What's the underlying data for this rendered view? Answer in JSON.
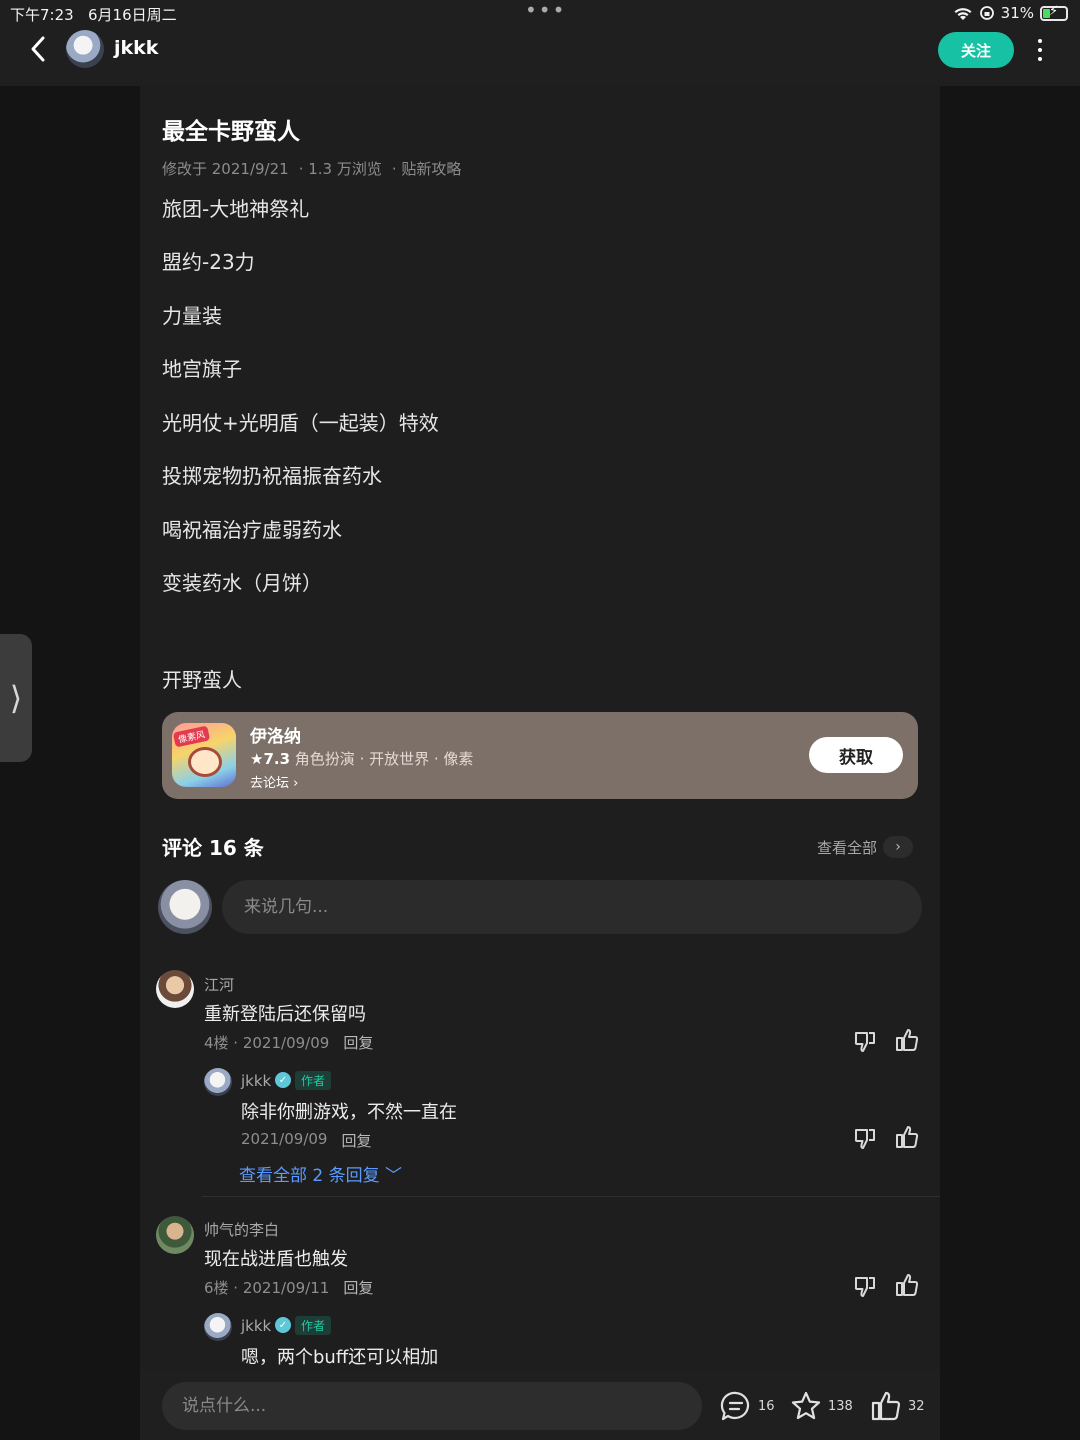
{
  "status": {
    "time": "下午7:23",
    "date": "6月16日周二",
    "battery": "31%",
    "battery_level": 0.31
  },
  "header": {
    "author": "jkkk",
    "follow_label": "关注"
  },
  "side_tab": {
    "glyph": "⟩"
  },
  "post": {
    "title": "最全卡野蛮人",
    "modified": "修改于 2021/9/21",
    "views": "· 1.3 万浏览",
    "category": "· 贴新攻略",
    "lines": [
      "旅团-大地神祭礼",
      "盟约-23力",
      "力量装",
      "地宫旗子",
      "光明仗+光明盾（一起装）特效",
      "投掷宠物扔祝福振奋药水",
      "喝祝福治疗虚弱药水",
      "变装药水（月饼）",
      "开野蛮人"
    ]
  },
  "game_card": {
    "name": "伊洛纳",
    "rating": "★7.3",
    "tags": " 角色扮演 · 开放世界 · 像素",
    "forum_link": "去论坛",
    "get_label": "获取",
    "icon_badge": "像素风"
  },
  "comments_section": {
    "title": "评论 16 条",
    "view_all": "查看全部",
    "input_placeholder": "来说几句..."
  },
  "comments": [
    {
      "name": "江河",
      "text": "重新登陆后还保留吗",
      "info": "4楼 · 2021/09/09",
      "reply_label": "回复",
      "reply": {
        "name": "jkkk",
        "author_tag": "作者",
        "text": "除非你删游戏，不然一直在",
        "date": "2021/09/09",
        "reply_label": "回复"
      },
      "more_replies": "查看全部 2 条回复 ﹀"
    },
    {
      "name": "帅气的李白",
      "text": "现在战进盾也触发",
      "info": "6楼 · 2021/09/11",
      "reply_label": "回复",
      "reply": {
        "name": "jkkk",
        "author_tag": "作者",
        "text": "嗯，两个buff还可以相加"
      }
    }
  ],
  "bottom_bar": {
    "input_placeholder": "说点什么...",
    "comments_count": "16",
    "favorites_count": "138",
    "likes_count": "32"
  }
}
